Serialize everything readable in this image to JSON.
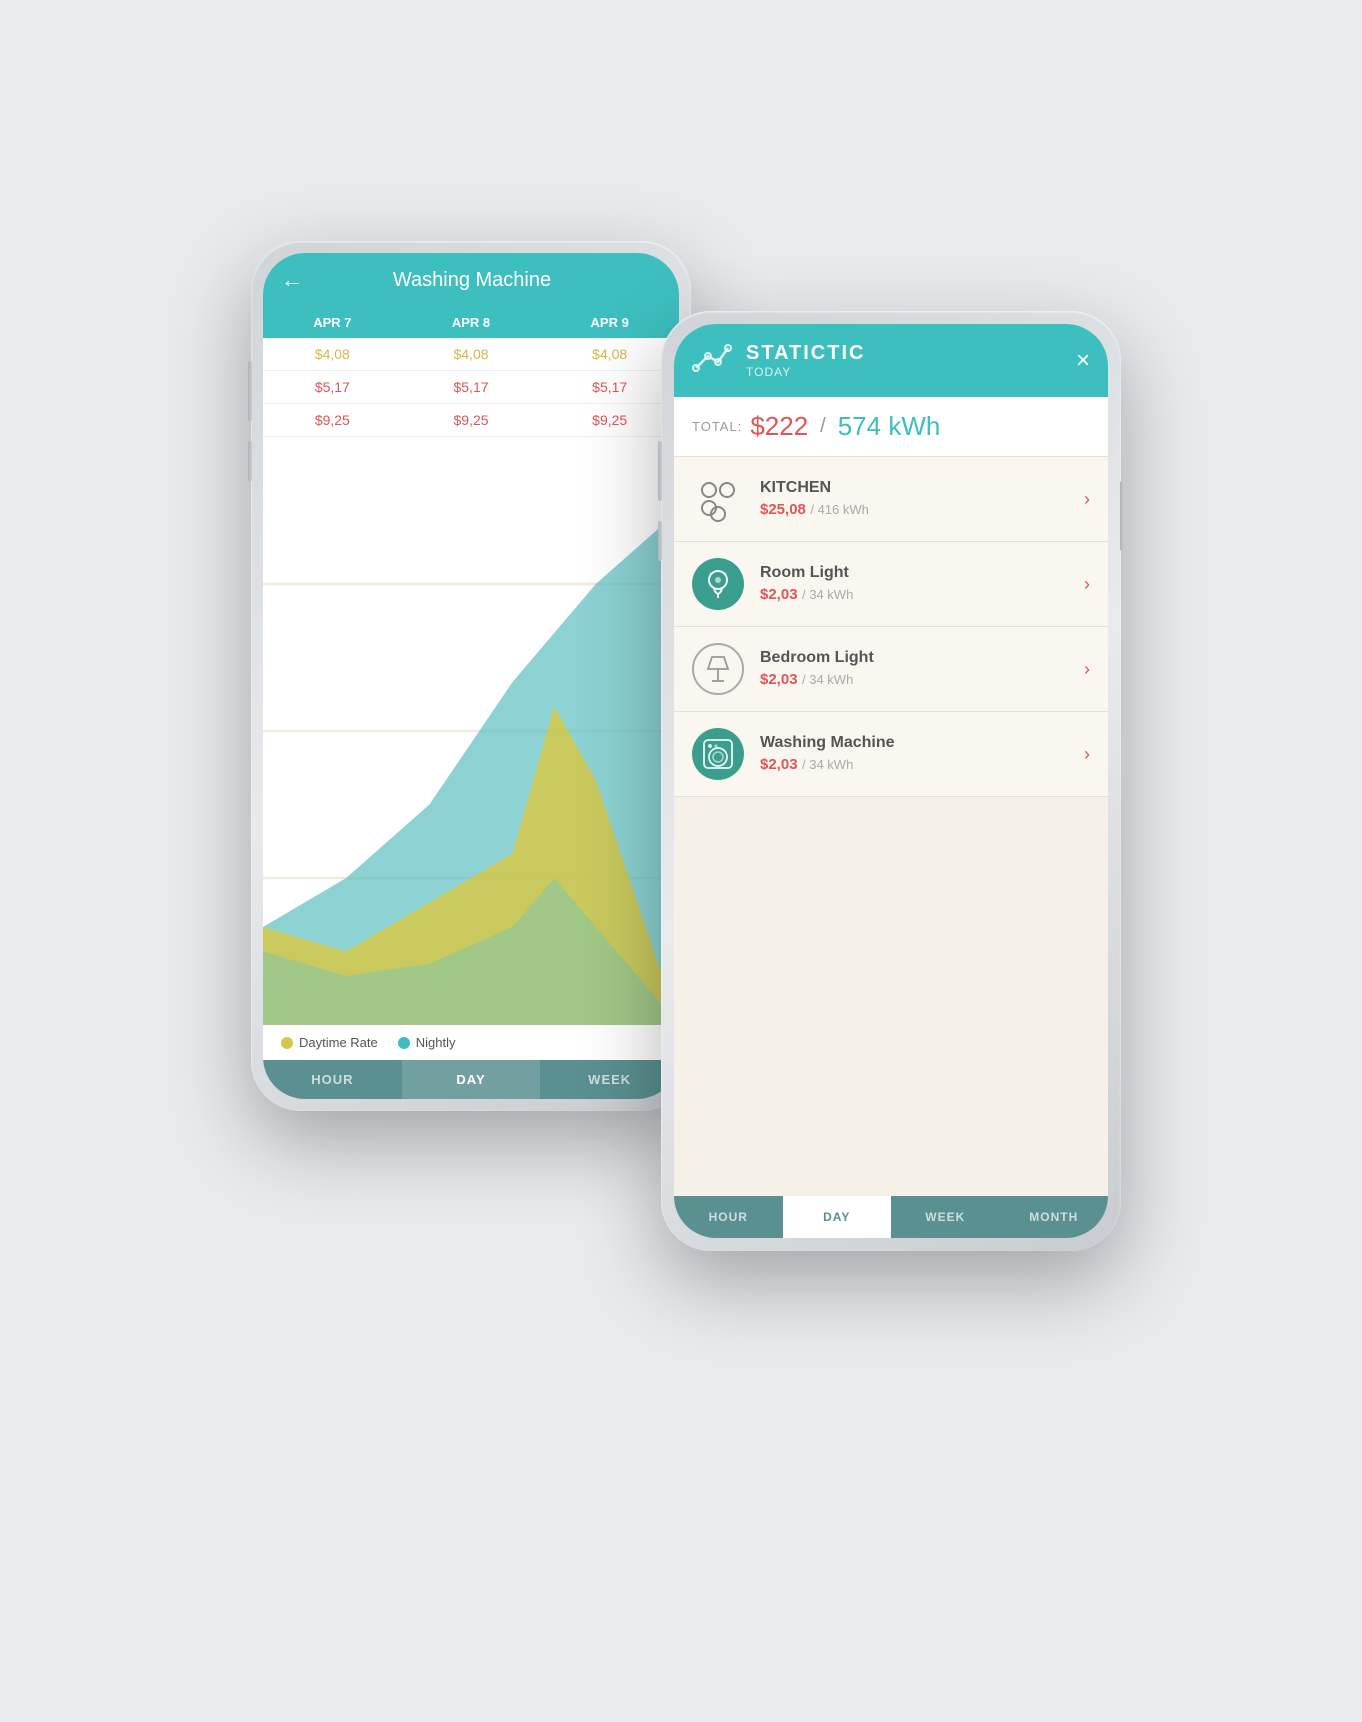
{
  "scene": {
    "bg_color": "#e8eaed"
  },
  "back_phone": {
    "header": {
      "back_label": "←",
      "title": "Washing Machine"
    },
    "table": {
      "columns": [
        "APR 7",
        "APR 8",
        "APR 9"
      ],
      "rows": [
        [
          "$4,08",
          "$4,08",
          "$4,08"
        ],
        [
          "$5,17",
          "$5,17",
          "$5,17"
        ],
        [
          "$9,25",
          "$9,25",
          "$9,25"
        ]
      ]
    },
    "legend": {
      "daytime_label": "Daytime Rate",
      "nightly_label": "Nightly",
      "daytime_color": "#d4c84a",
      "nightly_color": "#3dbfbf"
    },
    "tabs": [
      "HOUR",
      "DAY",
      "WEEK"
    ],
    "active_tab": "DAY"
  },
  "front_phone": {
    "header": {
      "title": "STATICTIC",
      "subtitle": "TODAY",
      "close_label": "×"
    },
    "total": {
      "label": "TOTAL:",
      "amount": "$222",
      "separator": "/",
      "kwh": "574 kWh"
    },
    "items": [
      {
        "name": "KITCHEN",
        "price": "$25,08",
        "kwh": "416 kWh",
        "icon_type": "kitchen"
      },
      {
        "name": "Room Light",
        "price": "$2,03",
        "kwh": "34 kWh",
        "icon_type": "bulb"
      },
      {
        "name": "Bedroom Light",
        "price": "$2,03",
        "kwh": "34 kWh",
        "icon_type": "lamp"
      },
      {
        "name": "Washing Machine",
        "price": "$2,03",
        "kwh": "34 kWh",
        "icon_type": "washer"
      }
    ],
    "tabs": [
      "HOUR",
      "DAY",
      "WEEK",
      "MONTH"
    ],
    "active_tab": "DAY"
  }
}
